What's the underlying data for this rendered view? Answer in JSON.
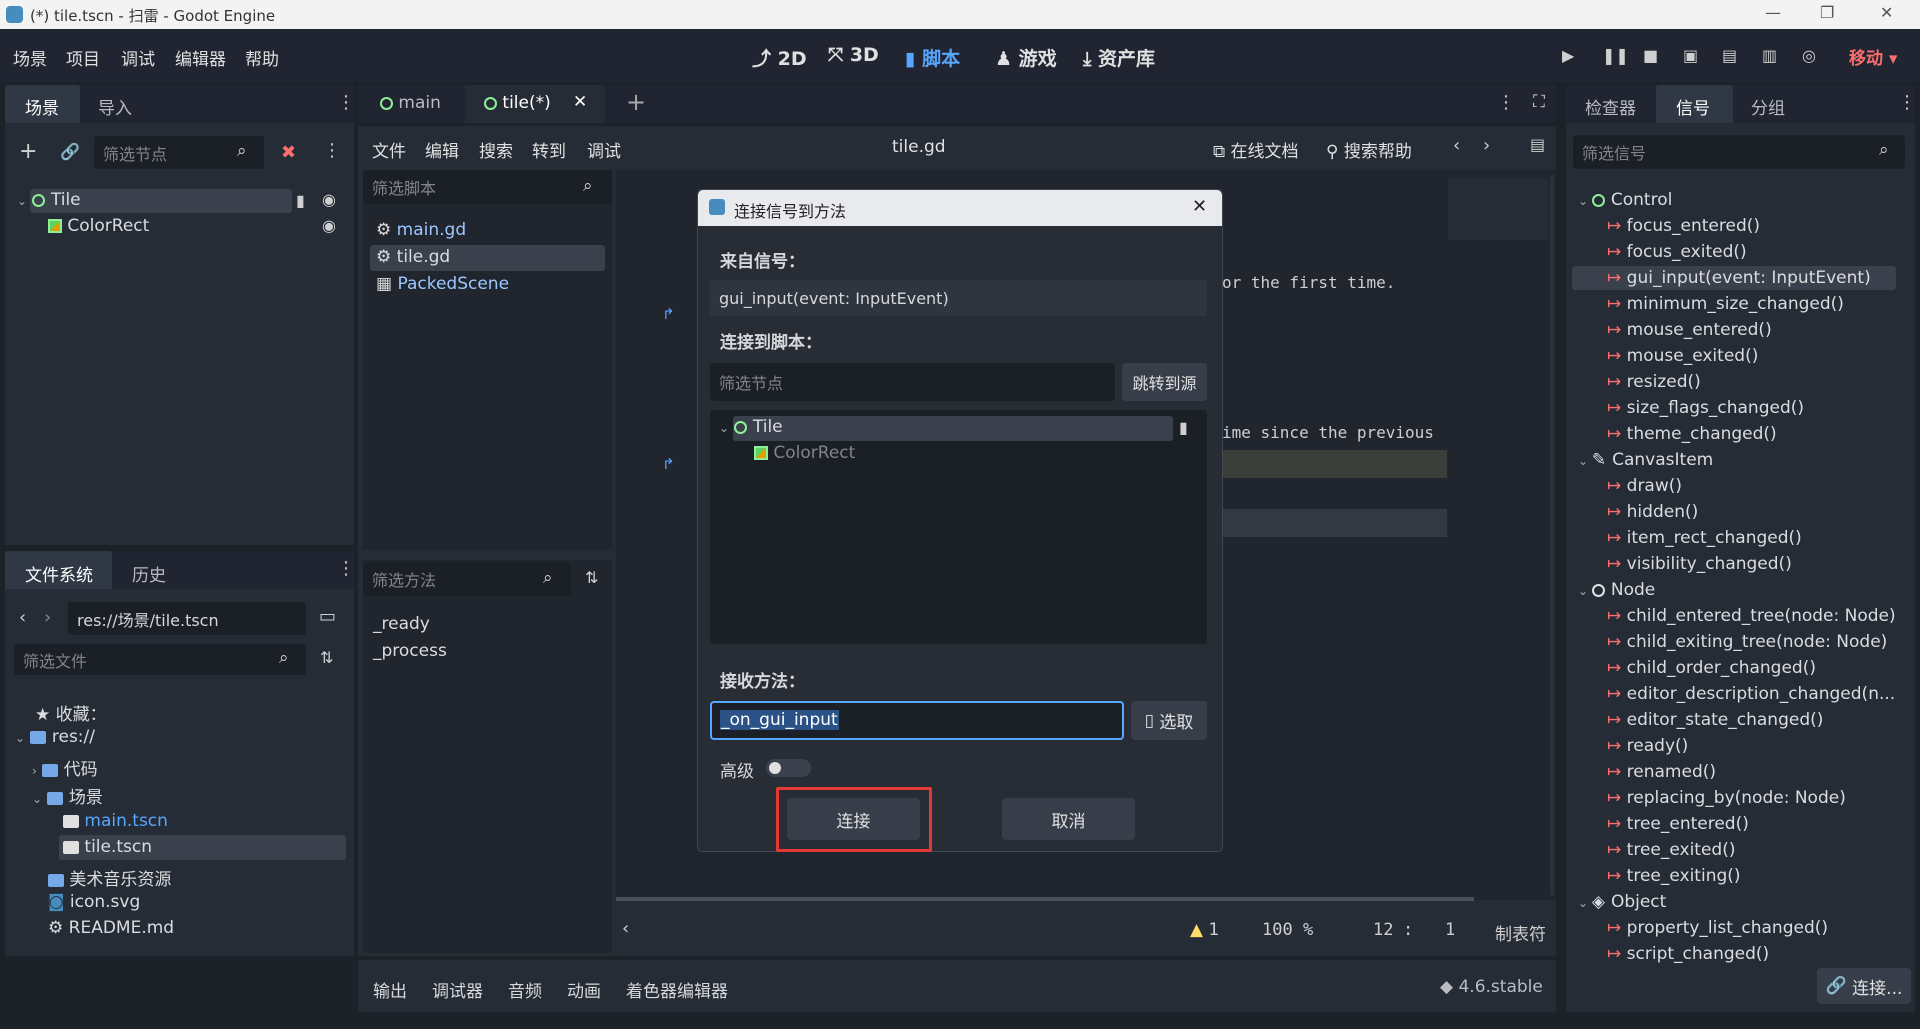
{
  "window": {
    "title": "(*) tile.tscn - 扫雷 - Godot Engine",
    "minimize": "—",
    "maximize": "❐",
    "close": "✕"
  },
  "menubar": {
    "items": [
      "场景",
      "项目",
      "调试",
      "编辑器",
      "帮助"
    ],
    "workspaces": [
      "2D",
      "3D",
      "脚本",
      "游戏",
      "资产库"
    ],
    "active_workspace": "脚本",
    "mode_label": "移动"
  },
  "scene_dock": {
    "tabs": [
      "场景",
      "导入"
    ],
    "filter_placeholder": "筛选节点",
    "nodes": [
      {
        "name": "Tile",
        "type": "Control"
      },
      {
        "name": "ColorRect",
        "type": "ColorRect"
      }
    ]
  },
  "filesystem_dock": {
    "tabs": [
      "文件系统",
      "历史"
    ],
    "path": "res://场景/tile.tscn",
    "filter_placeholder": "筛选文件",
    "favorites": "收藏：",
    "items": [
      {
        "label": "res://",
        "kind": "folder"
      },
      {
        "label": "代码",
        "kind": "folder"
      },
      {
        "label": "场景",
        "kind": "folder"
      },
      {
        "label": "main.tscn",
        "kind": "scene"
      },
      {
        "label": "tile.tscn",
        "kind": "scene"
      },
      {
        "label": "美术音乐资源",
        "kind": "folder"
      },
      {
        "label": "icon.svg",
        "kind": "image"
      },
      {
        "label": "README.md",
        "kind": "file"
      }
    ]
  },
  "editor_tabs": {
    "tabs": [
      "main",
      "tile(*)"
    ],
    "close": "✕",
    "add": "+"
  },
  "script_editor": {
    "menus": [
      "文件",
      "编辑",
      "搜索",
      "转到",
      "调试"
    ],
    "current_file": "tile.gd",
    "online_docs": "在线文档",
    "search_help": "搜索帮助",
    "filter_scripts_placeholder": "筛选脚本",
    "scripts": [
      "main.gd",
      "tile.gd",
      "PackedScene"
    ],
    "filter_methods_placeholder": "筛选方法",
    "methods": [
      "_ready",
      "_process"
    ],
    "code_line_1": "or the first time.",
    "code_line_2": "ime since the previous",
    "status": {
      "warnings": "1",
      "zoom": "100 %",
      "line": "12",
      "sep": ":",
      "col": "1",
      "indent": "制表符"
    }
  },
  "bottom_panel": {
    "tabs": [
      "输出",
      "调试器",
      "音频",
      "动画",
      "着色器编辑器"
    ],
    "version": "4.6.stable"
  },
  "inspector_dock": {
    "tabs": [
      "检查器",
      "信号",
      "分组"
    ],
    "filter_placeholder": "筛选信号",
    "connect_button": "连接...",
    "groups": [
      {
        "name": "Control",
        "signals": [
          "focus_entered()",
          "focus_exited()",
          "gui_input(event: InputEvent)",
          "minimum_size_changed()",
          "mouse_entered()",
          "mouse_exited()",
          "resized()",
          "size_flags_changed()",
          "theme_changed()"
        ]
      },
      {
        "name": "CanvasItem",
        "signals": [
          "draw()",
          "hidden()",
          "item_rect_changed()",
          "visibility_changed()"
        ]
      },
      {
        "name": "Node",
        "signals": [
          "child_entered_tree(node: Node)",
          "child_exiting_tree(node: Node)",
          "child_order_changed()",
          "editor_description_changed(n...",
          "editor_state_changed()",
          "ready()",
          "renamed()",
          "replacing_by(node: Node)",
          "tree_entered()",
          "tree_exited()",
          "tree_exiting()"
        ]
      },
      {
        "name": "Object",
        "signals": [
          "property_list_changed()",
          "script_changed()"
        ]
      }
    ]
  },
  "dialog": {
    "title": "连接信号到方法",
    "from_signal_label": "来自信号：",
    "from_signal_value": "gui_input(event: InputEvent)",
    "connect_to_script_label": "连接到脚本：",
    "filter_nodes_placeholder": "筛选节点",
    "goto_source": "跳转到源",
    "tree": [
      {
        "name": "Tile"
      },
      {
        "name": "ColorRect"
      }
    ],
    "receiver_label": "接收方法：",
    "receiver_value": "_on_gui_input",
    "pick_button": "选取",
    "advanced_label": "高级",
    "connect_button": "连接",
    "cancel_button": "取消"
  },
  "colors": {
    "accent": "#57a6ff",
    "signal": "#fb6e6e",
    "node_green": "#8eef97",
    "highlight_red": "#e53935"
  }
}
